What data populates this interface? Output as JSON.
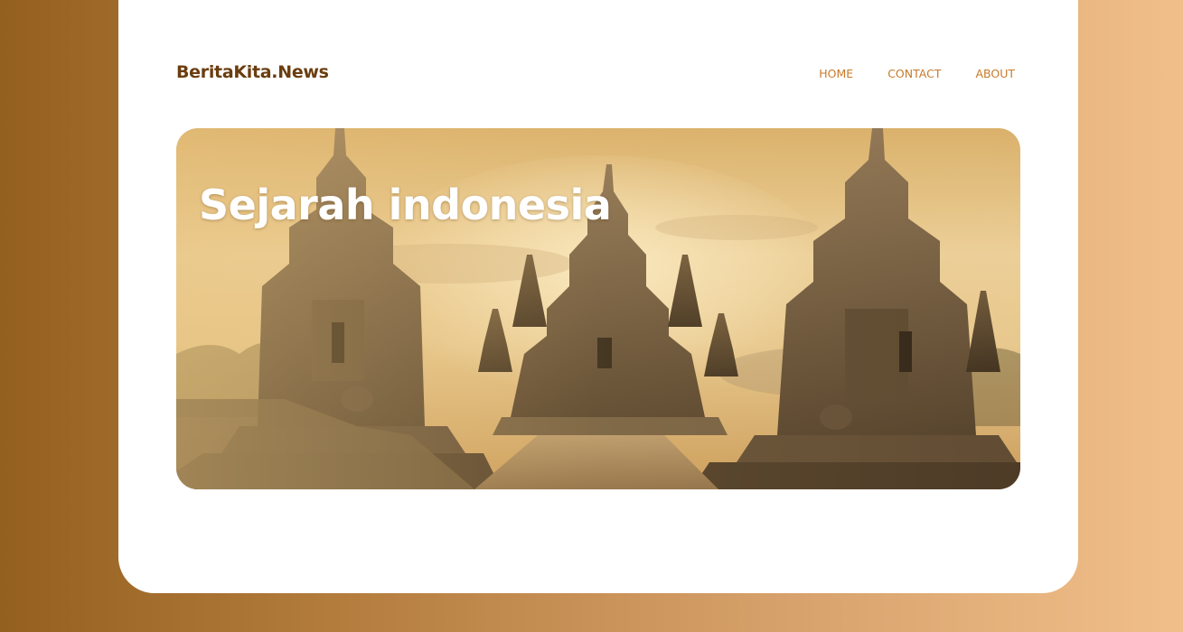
{
  "site": {
    "logo": "BeritaKita.News"
  },
  "nav": {
    "items": [
      {
        "label": "HOME"
      },
      {
        "label": "CONTACT"
      },
      {
        "label": "ABOUT"
      }
    ]
  },
  "hero": {
    "title": "Sejarah indonesia",
    "image_icon": "temple-photo"
  },
  "colors": {
    "logo": "#6b3d0f",
    "nav_link": "#c77a2a",
    "card": "#ffffff",
    "background_start": "#94601f",
    "background_end": "#f1bf8a"
  }
}
